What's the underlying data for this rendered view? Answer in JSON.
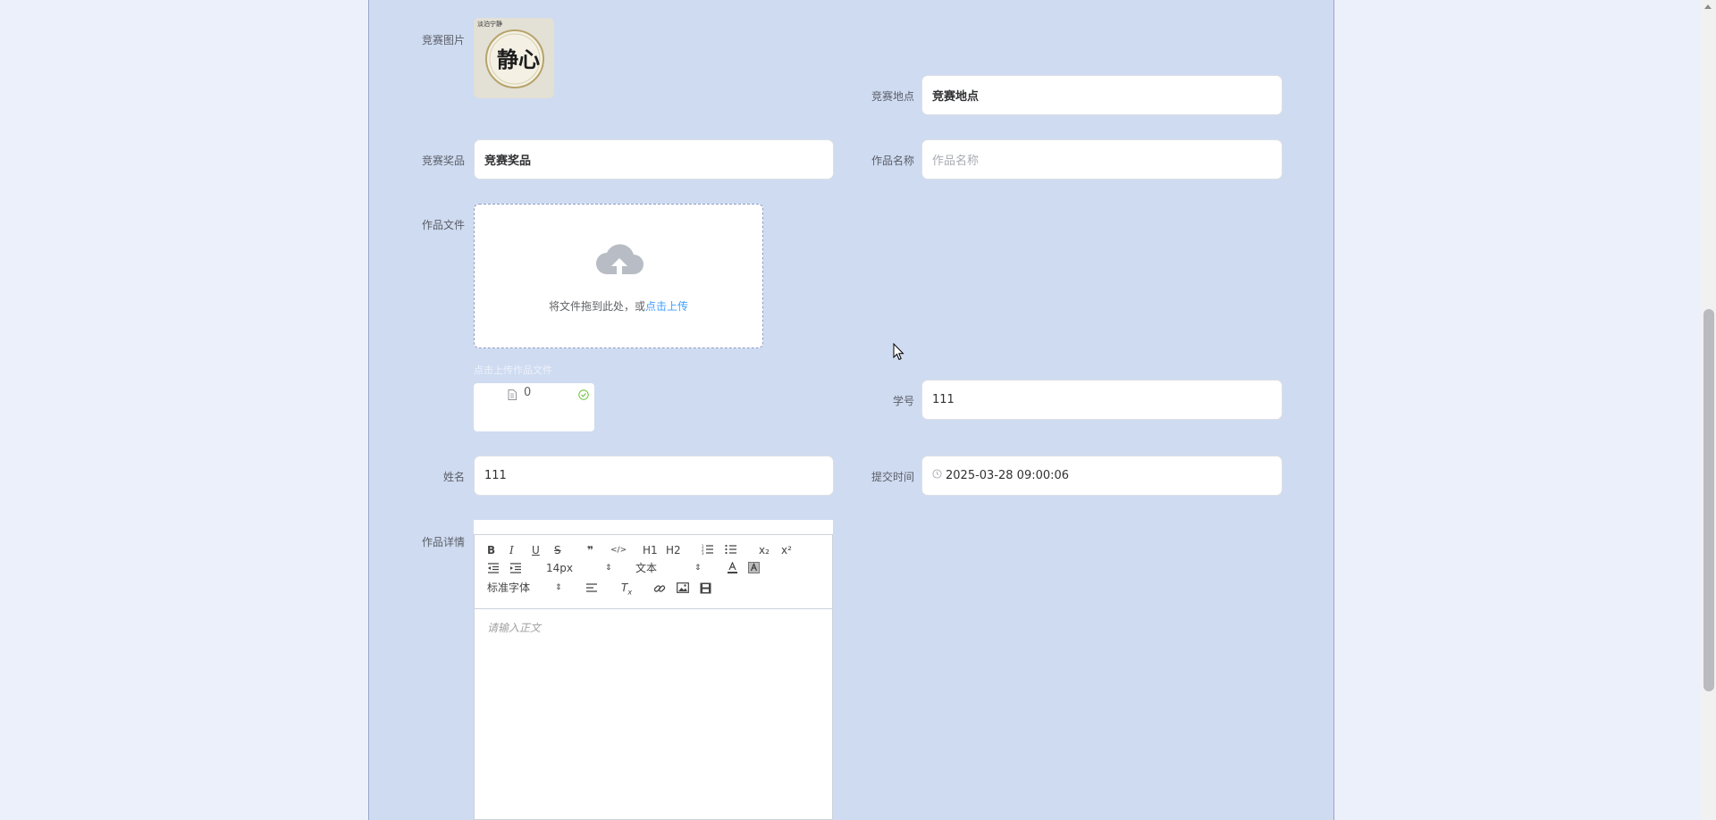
{
  "form": {
    "image_label": "竞赛图片",
    "location_label": "竞赛地点",
    "location_value": "竞赛地点",
    "prize_label": "竞赛奖品",
    "prize_value": "竞赛奖品",
    "work_name_label": "作品名称",
    "work_name_placeholder": "作品名称",
    "work_file_label": "作品文件",
    "upload_text": "将文件拖到此处，或",
    "upload_link": "点击上传",
    "upload_tip": "点击上传作品文件",
    "file_count": "0",
    "student_id_label": "学号",
    "student_id_value": "111",
    "name_label": "姓名",
    "name_value": "111",
    "submit_time_label": "提交时间",
    "submit_time_value": "2025-03-28 09:00:06",
    "detail_label": "作品详情"
  },
  "editor": {
    "font_size": "14px",
    "header_select": "文本",
    "font_family": "标准字体",
    "placeholder": "请输入正文",
    "toolbar": {
      "bold": "B",
      "italic": "I",
      "underline": "U",
      "strike": "S",
      "quote": "❞",
      "code": "</>",
      "h1": "H1",
      "h2": "H2",
      "sub": "x₂",
      "sup": "x²"
    }
  },
  "image": {
    "seal_text": "静心",
    "caption": "淡泊宁静"
  },
  "colors": {
    "panel": "#cfdbf1",
    "page": "#ecf0fb",
    "link": "#409eff"
  }
}
